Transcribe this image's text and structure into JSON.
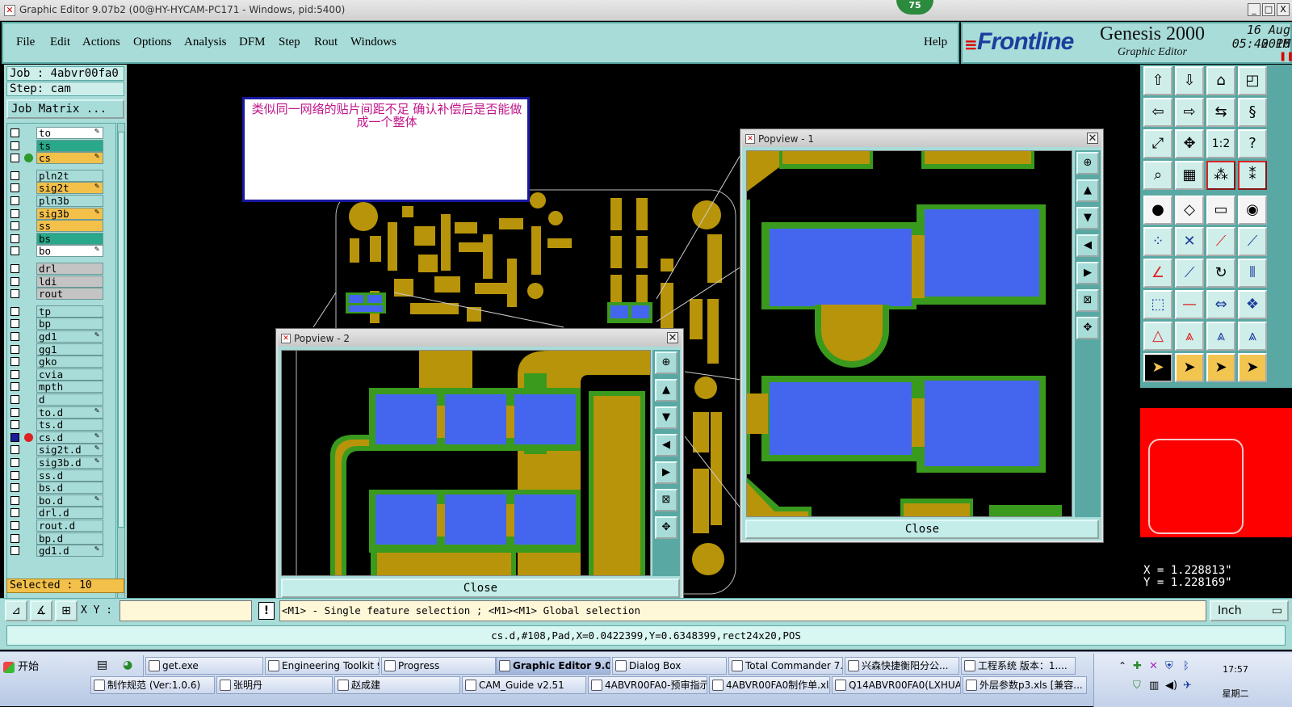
{
  "window": {
    "title": "Graphic Editor 9.07b2 (00@HY-HYCAM-PC171 - Windows, pid:5400)",
    "badge": "75",
    "buttons": [
      "_",
      "□",
      "X"
    ]
  },
  "menu": {
    "items": [
      "File",
      "Edit",
      "Actions",
      "Options",
      "Analysis",
      "DFM",
      "Step",
      "Rout",
      "Windows"
    ],
    "help": "Help"
  },
  "brand": {
    "logo": "Frontline",
    "product": "Genesis 2000",
    "subtitle": "Graphic Editor",
    "date": "16 Aug 2016",
    "time": "05:40 PM"
  },
  "job": {
    "job_line": "Job : 4abvr00fa0",
    "step_line": "Step: cam",
    "matrix_button": "Job Matrix ...",
    "selected": "Selected : 10"
  },
  "layers": [
    {
      "name": "to",
      "color": "#ffffff",
      "edit": true
    },
    {
      "name": "ts",
      "color": "#2aa88a",
      "edit": false
    },
    {
      "name": "cs",
      "color": "#f3c04a",
      "edit": true,
      "dot": "#2c9a2c"
    },
    {
      "name": "pln2t",
      "color": "#a8dcd8",
      "edit": false
    },
    {
      "name": "sig2t",
      "color": "#f3c04a",
      "edit": true
    },
    {
      "name": "pln3b",
      "color": "#a8dcd8",
      "edit": false
    },
    {
      "name": "sig3b",
      "color": "#f3c04a",
      "edit": true
    },
    {
      "name": "ss",
      "color": "#f3c04a",
      "edit": false
    },
    {
      "name": "bs",
      "color": "#2aa88a",
      "edit": false
    },
    {
      "name": "bo",
      "color": "#ffffff",
      "edit": true
    },
    {
      "name": "drl",
      "color": "#c4c4c4",
      "edit": false
    },
    {
      "name": "ldi",
      "color": "#c4c4c4",
      "edit": false
    },
    {
      "name": "rout",
      "color": "#c4c4c4",
      "edit": false
    },
    {
      "name": "tp",
      "color": "#a8dcd8",
      "edit": false
    },
    {
      "name": "bp",
      "color": "#a8dcd8",
      "edit": false
    },
    {
      "name": "gd1",
      "color": "#a8dcd8",
      "edit": true
    },
    {
      "name": "gg1",
      "color": "#a8dcd8",
      "edit": false
    },
    {
      "name": "gko",
      "color": "#a8dcd8",
      "edit": false
    },
    {
      "name": "cvia",
      "color": "#a8dcd8",
      "edit": false
    },
    {
      "name": "mpth",
      "color": "#a8dcd8",
      "edit": false
    },
    {
      "name": "d",
      "color": "#a8dcd8",
      "edit": false
    },
    {
      "name": "to.d",
      "color": "#a8dcd8",
      "edit": true
    },
    {
      "name": "ts.d",
      "color": "#a8dcd8",
      "edit": false
    },
    {
      "name": "cs.d",
      "color": "#a8dcd8",
      "edit": true,
      "active": true
    },
    {
      "name": "sig2t.d",
      "color": "#a8dcd8",
      "edit": true
    },
    {
      "name": "sig3b.d",
      "color": "#a8dcd8",
      "edit": true
    },
    {
      "name": "ss.d",
      "color": "#a8dcd8",
      "edit": false
    },
    {
      "name": "bs.d",
      "color": "#a8dcd8",
      "edit": false
    },
    {
      "name": "bo.d",
      "color": "#a8dcd8",
      "edit": true
    },
    {
      "name": "drl.d",
      "color": "#a8dcd8",
      "edit": false
    },
    {
      "name": "rout.d",
      "color": "#a8dcd8",
      "edit": false
    },
    {
      "name": "bp.d",
      "color": "#a8dcd8",
      "edit": false
    },
    {
      "name": "gd1.d",
      "color": "#a8dcd8",
      "edit": true
    }
  ],
  "note": {
    "text": "类似同一网络的贴片间距不足  确认补偿后是否能做成一个整体"
  },
  "popview1": {
    "title": "Popview - 1",
    "close": "Close"
  },
  "popview2": {
    "title": "Popview - 2",
    "close": "Close"
  },
  "coords": {
    "x": "X = 1.228813\"",
    "y": "Y = 1.228169\""
  },
  "command": {
    "xy_label": "X Y :",
    "xy_value": "",
    "hint": "<M1> - Single feature selection ; <M1><M1> Global selection",
    "units": "Inch"
  },
  "status": {
    "line": "cs.d,#108,Pad,X=0.0422399,Y=0.6348399,rect24x20,POS"
  },
  "taskbar": {
    "start": "开始",
    "row1": [
      "get.exe",
      "Engineering Toolkit 9....",
      "Progress",
      "Graphic Editor 9.07...",
      "Dialog Box",
      "Total Commander 7.0 ...",
      "兴森快捷衡阳分公...",
      "工程系统  版本：1...."
    ],
    "row2": [
      "制作规范 (Ver:1.0.6)",
      "张明丹",
      "赵成建",
      "CAM_Guide v2.51",
      "4ABVR00FA0-预审指示...",
      "4ABVR00FA0制作单.xl...",
      "Q14ABVR00FA0(LXHUA...",
      "外层参数p3.xls [兼容..."
    ],
    "time": "17:57",
    "weekday": "星期二"
  },
  "colors": {
    "copper": "#b8940a",
    "mask": "#3a9a1e",
    "pad": "#4466ee",
    "panel": "#a8dcd8"
  }
}
